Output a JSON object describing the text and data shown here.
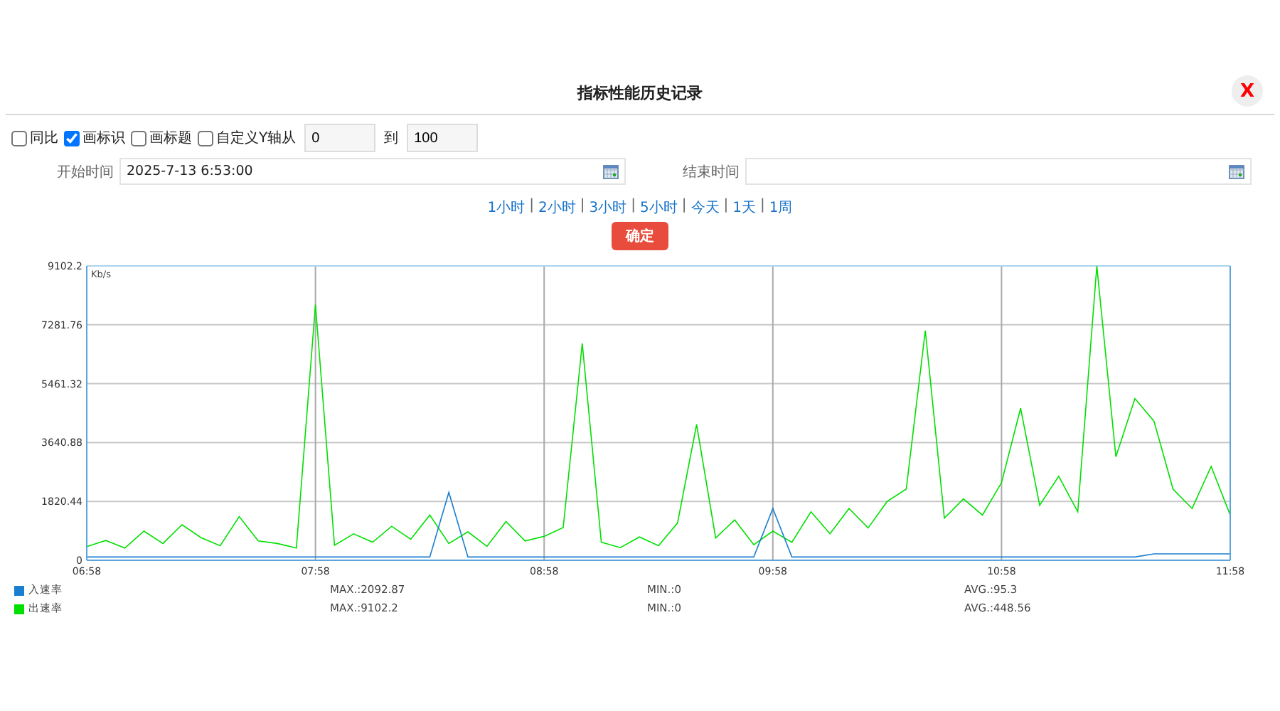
{
  "window": {
    "title": "指标性能历史记录",
    "close": "X"
  },
  "options": [
    {
      "label": "同比",
      "checked": false
    },
    {
      "label": "画标识",
      "checked": true
    },
    {
      "label": "画标题",
      "checked": false
    },
    {
      "label": "自定义Y轴从",
      "checked": false
    }
  ],
  "y_range": {
    "from": "0",
    "to_label": "到",
    "to": "100"
  },
  "start_time": {
    "label": "开始时间",
    "value": "2025-7-13 6:53:00"
  },
  "end_time": {
    "label": "结束时间"
  },
  "quick_ranges": {
    "separator": "|",
    "items": [
      "1小时",
      "2小时",
      "3小时",
      "5小时",
      "今天",
      "1天",
      "1周"
    ]
  },
  "confirm_button": "确定",
  "chart": {
    "chart_data": {
      "type": "line",
      "ylabel": "Kb/s",
      "categories": [
        "06:58",
        null,
        null,
        null,
        null,
        null,
        null,
        null,
        null,
        null,
        null,
        null,
        "07:58",
        null,
        null,
        null,
        null,
        null,
        null,
        null,
        null,
        null,
        null,
        null,
        "08:58",
        null,
        null,
        null,
        null,
        null,
        null,
        null,
        null,
        null,
        null,
        null,
        "09:58",
        null,
        null,
        null,
        null,
        null,
        null,
        null,
        null,
        null,
        null,
        null,
        "10:58",
        null,
        null,
        null,
        null,
        null,
        null,
        null,
        null,
        null,
        null,
        null,
        "11:58"
      ],
      "series": [
        {
          "name": "入速率",
          "color": "#1a7fd0",
          "values": [
            100,
            100,
            100,
            100,
            100,
            100,
            100,
            100,
            100,
            100,
            100,
            100,
            100,
            100,
            100,
            100,
            100,
            100,
            100,
            2100,
            100,
            100,
            100,
            100,
            100,
            100,
            100,
            100,
            100,
            100,
            100,
            100,
            100,
            100,
            100,
            100,
            1600,
            100,
            100,
            100,
            100,
            100,
            100,
            100,
            100,
            100,
            100,
            100,
            100,
            100,
            100,
            100,
            100,
            100,
            100,
            100,
            200,
            200,
            200,
            200,
            200
          ]
        },
        {
          "name": "出速率",
          "color": "#00e000",
          "values": [
            420,
            610,
            380,
            900,
            520,
            1100,
            700,
            450,
            1350,
            600,
            520,
            380,
            7900,
            460,
            820,
            560,
            1050,
            650,
            1400,
            520,
            880,
            430,
            1200,
            600,
            740,
            1010,
            6700,
            560,
            390,
            720,
            450,
            1150,
            4200,
            690,
            1250,
            480,
            900,
            560,
            1500,
            820,
            1600,
            1000,
            1820,
            2200,
            7100,
            1300,
            1900,
            1400,
            2400,
            4700,
            1700,
            2600,
            1500,
            9100,
            3200,
            5000,
            4300,
            2200,
            1600,
            2900,
            1400
          ]
        }
      ],
      "ylim": [
        0,
        9102.2
      ],
      "grid": true,
      "yticks": [
        {
          "value": 0,
          "label": "0"
        },
        {
          "value": 1820.44,
          "label": "1820.44"
        },
        {
          "value": 3640.88,
          "label": "3640.88"
        },
        {
          "value": 5461.32,
          "label": "5461.32"
        },
        {
          "value": 7281.76,
          "label": "7281.76"
        },
        {
          "value": 9102.2,
          "label": "9102.2"
        }
      ]
    }
  },
  "legend": [
    {
      "max": "MAX.:2092.87",
      "min": "MIN.:0",
      "avg": "AVG.:95.3"
    },
    {
      "max": "MAX.:9102.2",
      "min": "MIN.:0",
      "avg": "AVG.:448.56"
    }
  ]
}
